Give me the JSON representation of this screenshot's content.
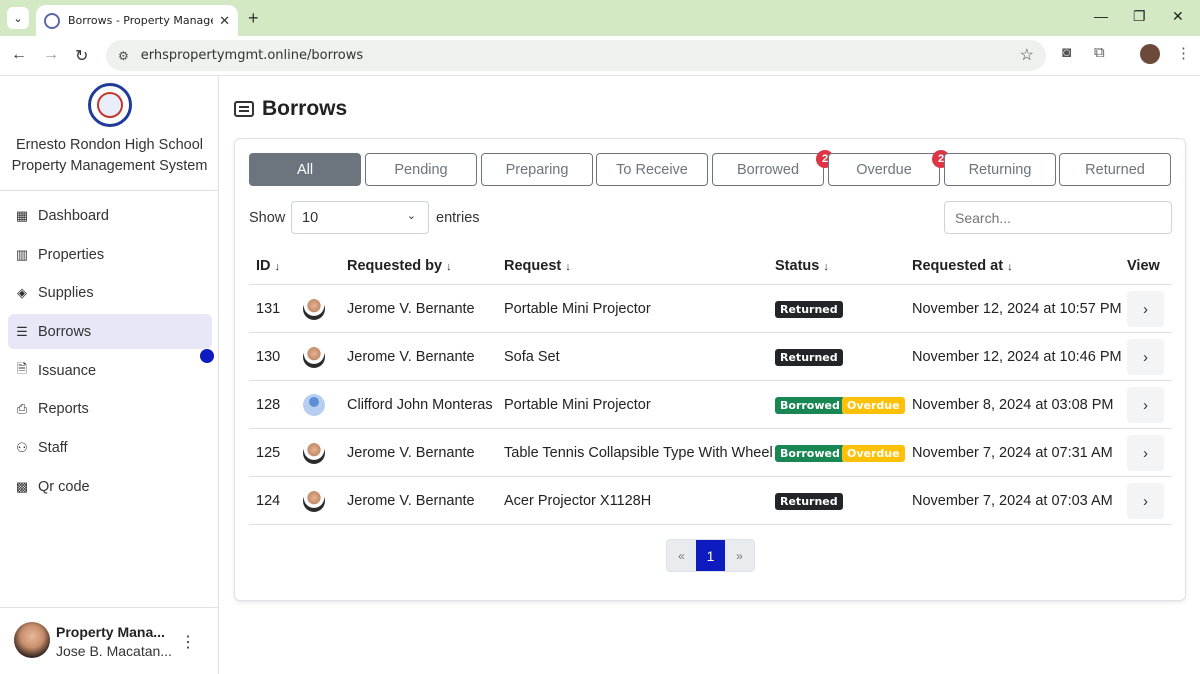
{
  "browser": {
    "tab_title": "Borrows - Property Management",
    "url": "erhspropertymgmt.online/borrows"
  },
  "sidebar": {
    "school_line1": "Ernesto Rondon High School",
    "school_line2": "Property Management System",
    "items": [
      {
        "label": "Dashboard",
        "icon": "grid-icon"
      },
      {
        "label": "Properties",
        "icon": "building-icon"
      },
      {
        "label": "Supplies",
        "icon": "box-icon"
      },
      {
        "label": "Borrows",
        "icon": "list-card-icon",
        "active": true
      },
      {
        "label": "Issuance",
        "icon": "file-check-icon"
      },
      {
        "label": "Reports",
        "icon": "printer-icon"
      },
      {
        "label": "Staff",
        "icon": "people-icon"
      },
      {
        "label": "Qr code",
        "icon": "qr-code-icon"
      }
    ],
    "user_name": "Property Mana...",
    "user_subtitle": "Jose B. Macatan..."
  },
  "main": {
    "title": "Borrows",
    "filters": [
      {
        "label": "All",
        "active": true
      },
      {
        "label": "Pending"
      },
      {
        "label": "Preparing"
      },
      {
        "label": "To Receive"
      },
      {
        "label": "Borrowed",
        "count": "2"
      },
      {
        "label": "Overdue",
        "count": "2"
      },
      {
        "label": "Returning"
      },
      {
        "label": "Returned"
      }
    ],
    "show_label": "Show",
    "entries_value": "10",
    "entries_label": "entries",
    "search_placeholder": "Search...",
    "columns": {
      "id": "ID",
      "requested_by": "Requested by",
      "request": "Request",
      "status": "Status",
      "requested_at": "Requested at",
      "view": "View"
    },
    "rows": [
      {
        "id": "131",
        "requested_by": "Jerome V. Bernante",
        "request": "Portable Mini Projector",
        "status": [
          "Returned"
        ],
        "requested_at": "November 12, 2024 at 10:57 PM"
      },
      {
        "id": "130",
        "requested_by": "Jerome V. Bernante",
        "request": "Sofa Set",
        "status": [
          "Returned"
        ],
        "requested_at": "November 12, 2024 at 10:46 PM"
      },
      {
        "id": "128",
        "requested_by": "Clifford John Monteras",
        "request": "Portable Mini Projector",
        "status": [
          "Borrowed",
          "Overdue"
        ],
        "requested_at": "November 8, 2024 at 03:08 PM"
      },
      {
        "id": "125",
        "requested_by": "Jerome V. Bernante",
        "request": "Table Tennis Collapsible Type With Wheel",
        "status": [
          "Borrowed",
          "Overdue"
        ],
        "requested_at": "November 7, 2024 at 07:31 AM"
      },
      {
        "id": "124",
        "requested_by": "Jerome V. Bernante",
        "request": "Acer Projector X1128H",
        "status": [
          "Returned"
        ],
        "requested_at": "November 7, 2024 at 07:03 AM"
      }
    ],
    "pagination": {
      "prev": "«",
      "current": "1",
      "next": "»"
    }
  },
  "colors": {
    "accent": "#0d1bbf",
    "returned": "#212529",
    "borrowed": "#198754",
    "overdue": "#ffc107",
    "count_badge": "#dc3545"
  }
}
